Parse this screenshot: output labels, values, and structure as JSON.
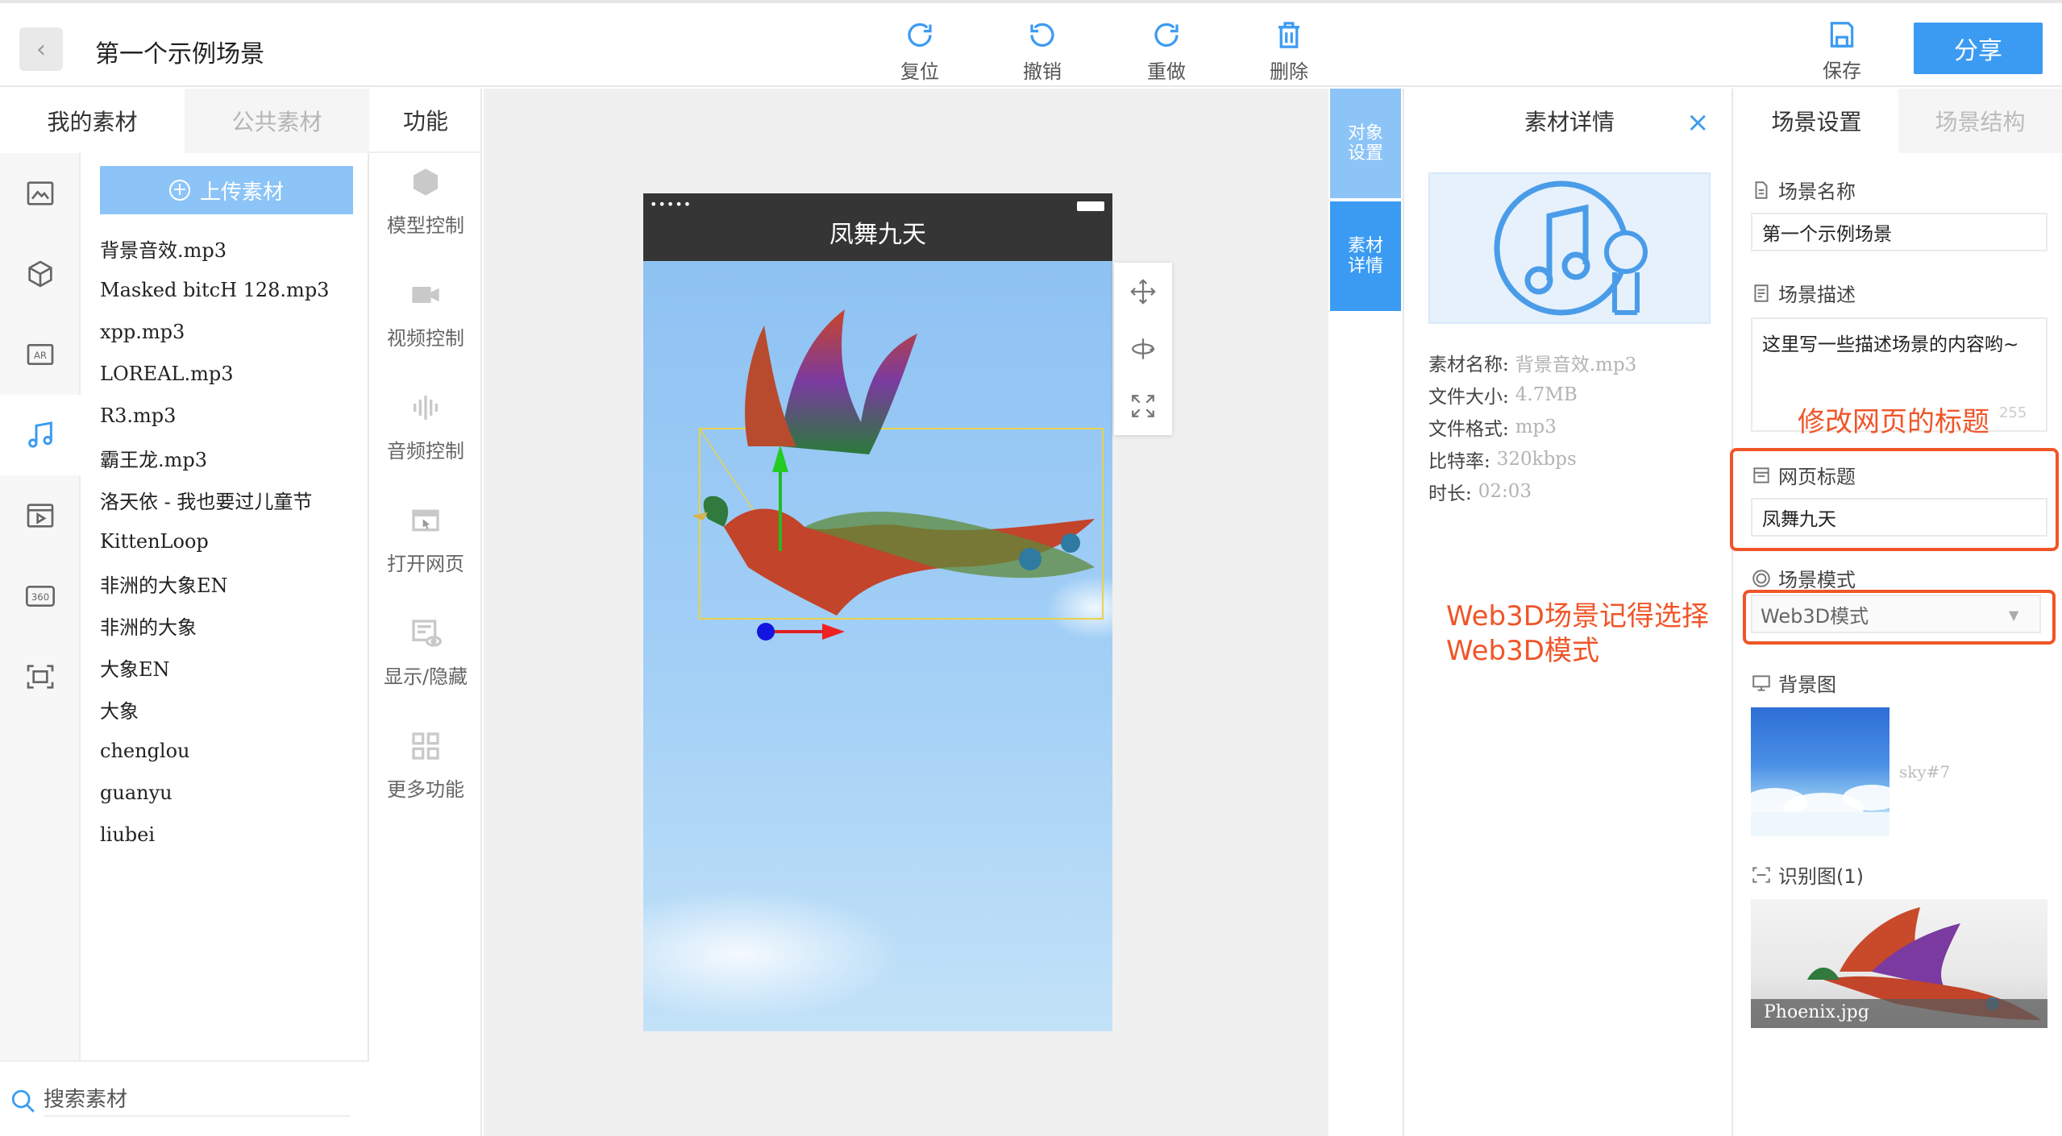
{
  "header": {
    "back_label": "<",
    "scene_title": "第一个示例场景",
    "toolbar": [
      {
        "label": "复位",
        "icon": "refresh-icon"
      },
      {
        "label": "撤销",
        "icon": "undo-icon"
      },
      {
        "label": "重做",
        "icon": "redo-icon"
      },
      {
        "label": "删除",
        "icon": "trash-icon"
      }
    ],
    "save_label": "保存",
    "share_label": "分享"
  },
  "left_panel": {
    "tabs": [
      "我的素材",
      "公共素材"
    ],
    "categories": [
      "image-icon",
      "cube-icon",
      "ar-icon",
      "music-icon",
      "video-icon",
      "panorama-360-icon",
      "scan-icon"
    ],
    "upload_label": "上传素材",
    "files": [
      "背景音效.mp3",
      "Masked bitcH 128.mp3",
      "xpp.mp3",
      "LOREAL.mp3",
      "R3.mp3",
      "霸王龙.mp3",
      "洛天依 - 我也要过儿童节",
      "KittenLoop",
      "非洲的大象EN",
      "非洲的大象",
      "大象EN",
      "大象",
      "chenglou",
      "guanyu",
      "liubei"
    ],
    "search_placeholder": "搜索素材"
  },
  "functions": {
    "title": "功能",
    "items": [
      "模型控制",
      "视频控制",
      "音频控制",
      "打开网页",
      "显示/隐藏",
      "更多功能"
    ]
  },
  "canvas": {
    "phone_dots": "•••••",
    "phone_title": "凤舞九天"
  },
  "side_tabs": {
    "object_settings": "对象\n设置",
    "material_detail": "素材\n详情"
  },
  "detail": {
    "title": "素材详情",
    "close": "×",
    "rows": [
      {
        "k": "素材名称:",
        "v": "背景音效.mp3"
      },
      {
        "k": "文件大小:",
        "v": "4.7MB"
      },
      {
        "k": "文件格式:",
        "v": "mp3"
      },
      {
        "k": "比特率:",
        "v": "320kbps"
      },
      {
        "k": "时长:",
        "v": "02:03"
      }
    ]
  },
  "annotations": {
    "web3d_note": "Web3D场景记得选择\nWeb3D模式",
    "title_note": "修改网页的标题",
    "color": "#f05528"
  },
  "settings": {
    "tabs": [
      "场景设置",
      "场景结构"
    ],
    "scene_name_label": "场景名称",
    "scene_name_value": "第一个示例场景",
    "scene_desc_label": "场景描述",
    "scene_desc_value": "这里写一些描述场景的内容哟~",
    "scene_desc_count": "255",
    "page_title_label": "网页标题",
    "page_title_value": "凤舞九天",
    "scene_mode_label": "场景模式",
    "scene_mode_value": "Web3D模式",
    "bg_label": "背景图",
    "bg_caption": "sky#7",
    "marker_label": "识别图(1)",
    "marker_caption": "Phoenix.jpg"
  },
  "colors": {
    "accent": "#3b9bf2",
    "accent_light": "#8cc4f7"
  }
}
